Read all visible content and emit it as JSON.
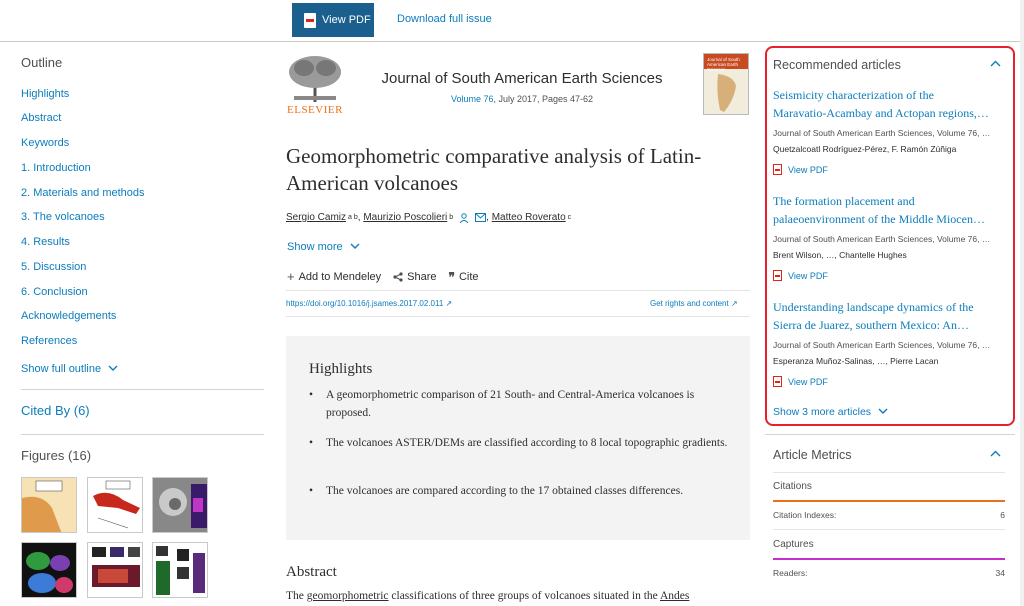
{
  "toolbar": {
    "view_pdf": "View PDF",
    "download_issue": "Download full issue"
  },
  "outline": {
    "title": "Outline",
    "items": [
      "Highlights",
      "Abstract",
      "Keywords",
      "1. Introduction",
      "2. Materials and methods",
      "3. The volcanoes",
      "4. Results",
      "5. Discussion",
      "6. Conclusion",
      "Acknowledgements",
      "References"
    ],
    "show_full": "Show full outline"
  },
  "cited_by": "Cited By (6)",
  "figures": {
    "title": "Figures (16)"
  },
  "journal": {
    "publisher": "ELSEVIER",
    "name": "Journal of South American Earth Sciences",
    "volume": "Volume 76",
    "meta_rest": ", July 2017, Pages 47-62",
    "cover_name": "Journal of South American Earth Sciences"
  },
  "article": {
    "title": "Geomorphometric comparative analysis of Latin-American volcanoes",
    "authors": [
      {
        "name": "Sergio Camiz",
        "sup": "a b"
      },
      {
        "name": "Maurizio Poscolieri",
        "sup": "b"
      },
      {
        "name": "Matteo Roverato",
        "sup": "c"
      }
    ],
    "author_sep": ",",
    "show_more": "Show more",
    "actions": {
      "mendeley": "Add to Mendeley",
      "share": "Share",
      "cite": "Cite"
    },
    "doi": "https://doi.org/10.1016/j.jsames.2017.02.011",
    "rights": "Get rights and content"
  },
  "highlights": {
    "title": "Highlights",
    "items": [
      "A geomorphometric comparison of 21 South- and Central-America volcanoes is proposed.",
      "The volcanoes ASTER/DEMs are classified according to 8 local topographic gradients.",
      "The volcanoes are compared according to the 17 obtained classes differences."
    ]
  },
  "abstract": {
    "title": "Abstract",
    "text_start": "The ",
    "text_link": "geomorphometric",
    "text_mid": " classifications of three groups of volcanoes situated in the ",
    "text_link2": "Andes"
  },
  "recommended": {
    "title": "Recommended articles",
    "articles": [
      {
        "title1": "Seismicity characterization of the",
        "title2": "Maravatio-Acambay and Actopan regions,…",
        "meta": "Journal of South American Earth Sciences, Volume 76, …",
        "authors": "Quetzalcoatl Rodríguez-Pérez, F. Ramón Zúñiga",
        "pdf": "View PDF"
      },
      {
        "title1": "The formation placement and",
        "title2": "palaeoenvironment of the Middle Miocen…",
        "meta": "Journal of South American Earth Sciences, Volume 76, …",
        "authors": "Brent Wilson, …, Chantelle Hughes",
        "pdf": "View PDF"
      },
      {
        "title1": "Understanding landscape dynamics of the",
        "title2": "Sierra de Juarez, southern Mexico: An…",
        "meta": "Journal of South American Earth Sciences, Volume 76, …",
        "authors": "Esperanza Muñoz-Salinas, …, Pierre Lacan",
        "pdf": "View PDF"
      }
    ],
    "show_more": "Show 3 more articles"
  },
  "metrics": {
    "title": "Article Metrics",
    "citations_label": "Citations",
    "citation_indexes_label": "Citation Indexes:",
    "citation_indexes_value": "6",
    "captures_label": "Captures",
    "readers_label": "Readers:",
    "readers_value": "34"
  },
  "colors": {
    "link": "#0c7dbb",
    "pdf_button": "#1a5f8e",
    "highlight_border": "#e8202e",
    "citations_bar": "#e9711c",
    "captures_bar": "#c62fc9",
    "elsevier_orange": "#e9711c"
  }
}
